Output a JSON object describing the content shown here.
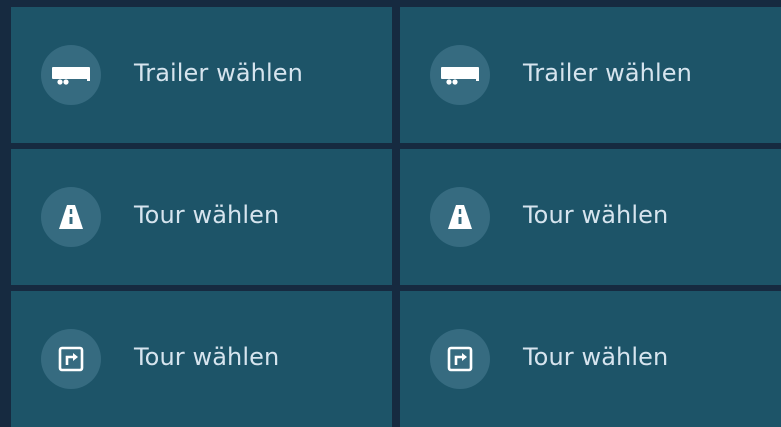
{
  "tiles": [
    {
      "label": "Trailer wählen",
      "icon": "trailer-icon"
    },
    {
      "label": "Trailer wählen",
      "icon": "trailer-icon"
    },
    {
      "label": "Tour wählen",
      "icon": "road-icon"
    },
    {
      "label": "Tour wählen",
      "icon": "road-icon"
    },
    {
      "label": "Tour wählen",
      "icon": "turn-right-sign-icon"
    },
    {
      "label": "Tour wählen",
      "icon": "turn-right-sign-icon"
    }
  ],
  "colors": {
    "background": "#162a40",
    "tile": "#1d5468",
    "icon_circle": "#366b80",
    "text": "#d6e4ee",
    "icon": "#ffffff"
  }
}
